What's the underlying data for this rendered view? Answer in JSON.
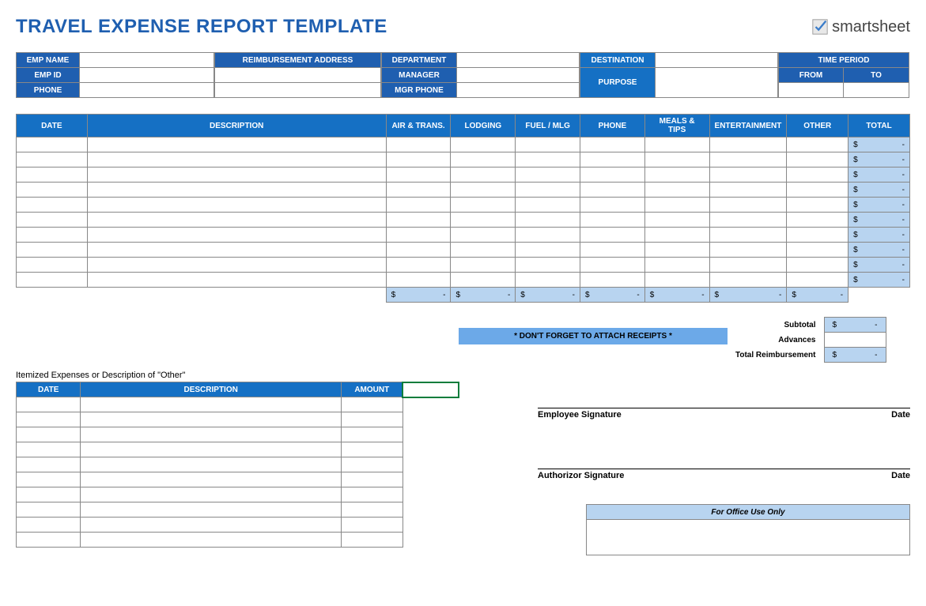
{
  "title": "TRAVEL EXPENSE REPORT TEMPLATE",
  "logo": {
    "text": "smartsheet"
  },
  "info": {
    "emp_name": "EMP NAME",
    "emp_id": "EMP ID",
    "phone": "PHONE",
    "reimb_addr": "REIMBURSEMENT ADDRESS",
    "department": "DEPARTMENT",
    "manager": "MANAGER",
    "mgr_phone": "MGR PHONE",
    "destination": "DESTINATION",
    "purpose": "PURPOSE",
    "time_period": "TIME PERIOD",
    "from": "FROM",
    "to": "TO"
  },
  "main_headers": {
    "date": "DATE",
    "desc": "DESCRIPTION",
    "air": "AIR & TRANS.",
    "lodging": "LODGING",
    "fuel": "FUEL / MLG",
    "phone": "PHONE",
    "meals": "MEALS & TIPS",
    "ent": "ENTERTAINMENT",
    "other": "OTHER",
    "total": "TOTAL"
  },
  "row_total": {
    "dollar": "$",
    "dash": "-"
  },
  "col_sub": {
    "dollar": "$",
    "dash": "-"
  },
  "receipts_note": "* DON'T FORGET TO ATTACH RECEIPTS *",
  "summary": {
    "subtotal": "Subtotal",
    "advances": "Advances",
    "total_reimb": "Total Reimbursement"
  },
  "itemized": {
    "label": "Itemized Expenses or Description of \"Other\"",
    "date": "DATE",
    "desc": "DESCRIPTION",
    "amount": "AMOUNT"
  },
  "sig": {
    "emp": "Employee Signature",
    "auth": "Authorizor Signature",
    "date": "Date"
  },
  "office": "For Office Use Only"
}
